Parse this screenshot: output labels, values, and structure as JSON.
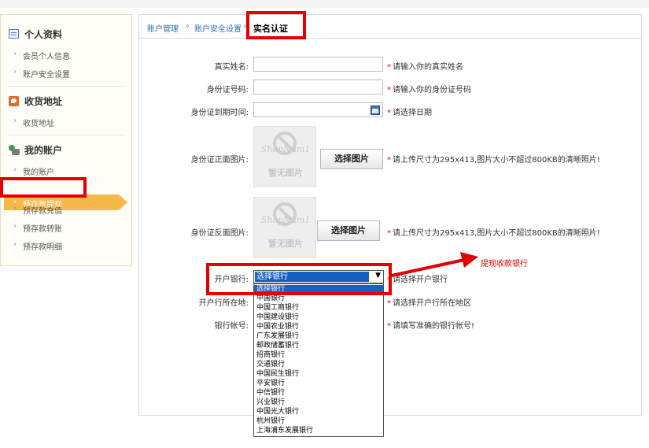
{
  "sidebar": {
    "sections": [
      {
        "title": "个人资料",
        "icon": "profile-card-icon",
        "items": [
          "会员个人信息",
          "账户安全设置"
        ]
      },
      {
        "title": "收货地址",
        "icon": "address-icon",
        "items": [
          "收货地址"
        ]
      },
      {
        "title": "我的账户",
        "icon": "account-icon",
        "items": [
          "我的账户",
          "预存款提现",
          "预存款充值",
          "预存款转账",
          "预存款明细"
        ]
      }
    ],
    "active_item": "预存款提现",
    "active_color": "#f7b84a"
  },
  "breadcrumb": {
    "items": [
      "账户管理",
      "账户安全设置"
    ],
    "separator": "»",
    "current": "实名认证"
  },
  "form": {
    "real_name": {
      "label": "真实姓名:",
      "value": "",
      "hint": "请输入你的真实姓名"
    },
    "id_number": {
      "label": "身份证号码:",
      "value": "",
      "hint": "请输入你的身份证号码"
    },
    "id_expiry": {
      "label": "身份证到期时间:",
      "value": "",
      "hint": "请选择日期",
      "icon": "calendar-icon"
    },
    "id_front": {
      "label": "身份证正面图片:",
      "button": "选择图片",
      "hint": "请上传尺寸为295x413,图片大小不超过800KB的清晰照片!",
      "placeholder_brand": "ShopNum1",
      "placeholder_text": "暂无图片"
    },
    "id_back": {
      "label": "身份证反面图片:",
      "button": "选择图片",
      "hint": "请上传尺寸为295x413,图片大小不超过800KB的清晰照片!",
      "placeholder_brand": "ShopNum1",
      "placeholder_text": "暂无图片"
    },
    "bank": {
      "label": "开户银行:",
      "selected": "选择银行",
      "hint": "请选择开户银行",
      "options": [
        "选择银行",
        "中国银行",
        "中国工商银行",
        "中国建设银行",
        "中国农业银行",
        "广东发展银行",
        "邮政储蓄银行",
        "招商银行",
        "交通银行",
        "中国民生银行",
        "平安银行",
        "中信银行",
        "兴业银行",
        "中国光大银行",
        "杭州银行",
        "上海浦东发展银行"
      ]
    },
    "bank_location": {
      "label": "开户行所在地:",
      "hint": "请选择开户行所在地区"
    },
    "bank_account": {
      "label": "银行帐号:",
      "hint": "请填写准确的银行帐号!"
    },
    "required_mark": "*"
  },
  "annotation": {
    "text": "提现收款银行",
    "color": "#e20000"
  }
}
